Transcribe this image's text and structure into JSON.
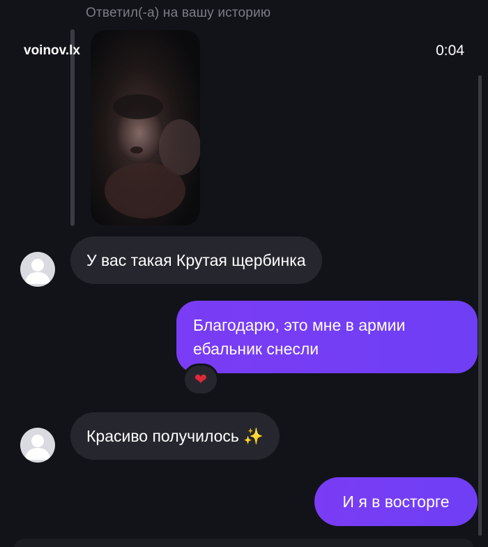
{
  "header": {
    "reply_label": "Ответил(-а) на вашу историю",
    "username": "voinov.lx",
    "timer": "0:04"
  },
  "messages": [
    {
      "sender": "other",
      "text": "У вас такая Крутая щербинка"
    },
    {
      "sender": "me",
      "text": "Благодарю, это мне в армии ебальник снесли",
      "reaction": "❤"
    },
    {
      "sender": "other",
      "text": "Красиво получилось ✨"
    },
    {
      "sender": "me",
      "text": "И я в восторге"
    }
  ],
  "colors": {
    "background": "#121318",
    "incoming_bubble": "#26272e",
    "outgoing_bubble": "#7a3cf5",
    "reaction_heart": "#e0283a"
  },
  "icons": [
    "avatar-placeholder-icon",
    "heart-reaction-icon",
    "sparkles-icon"
  ]
}
